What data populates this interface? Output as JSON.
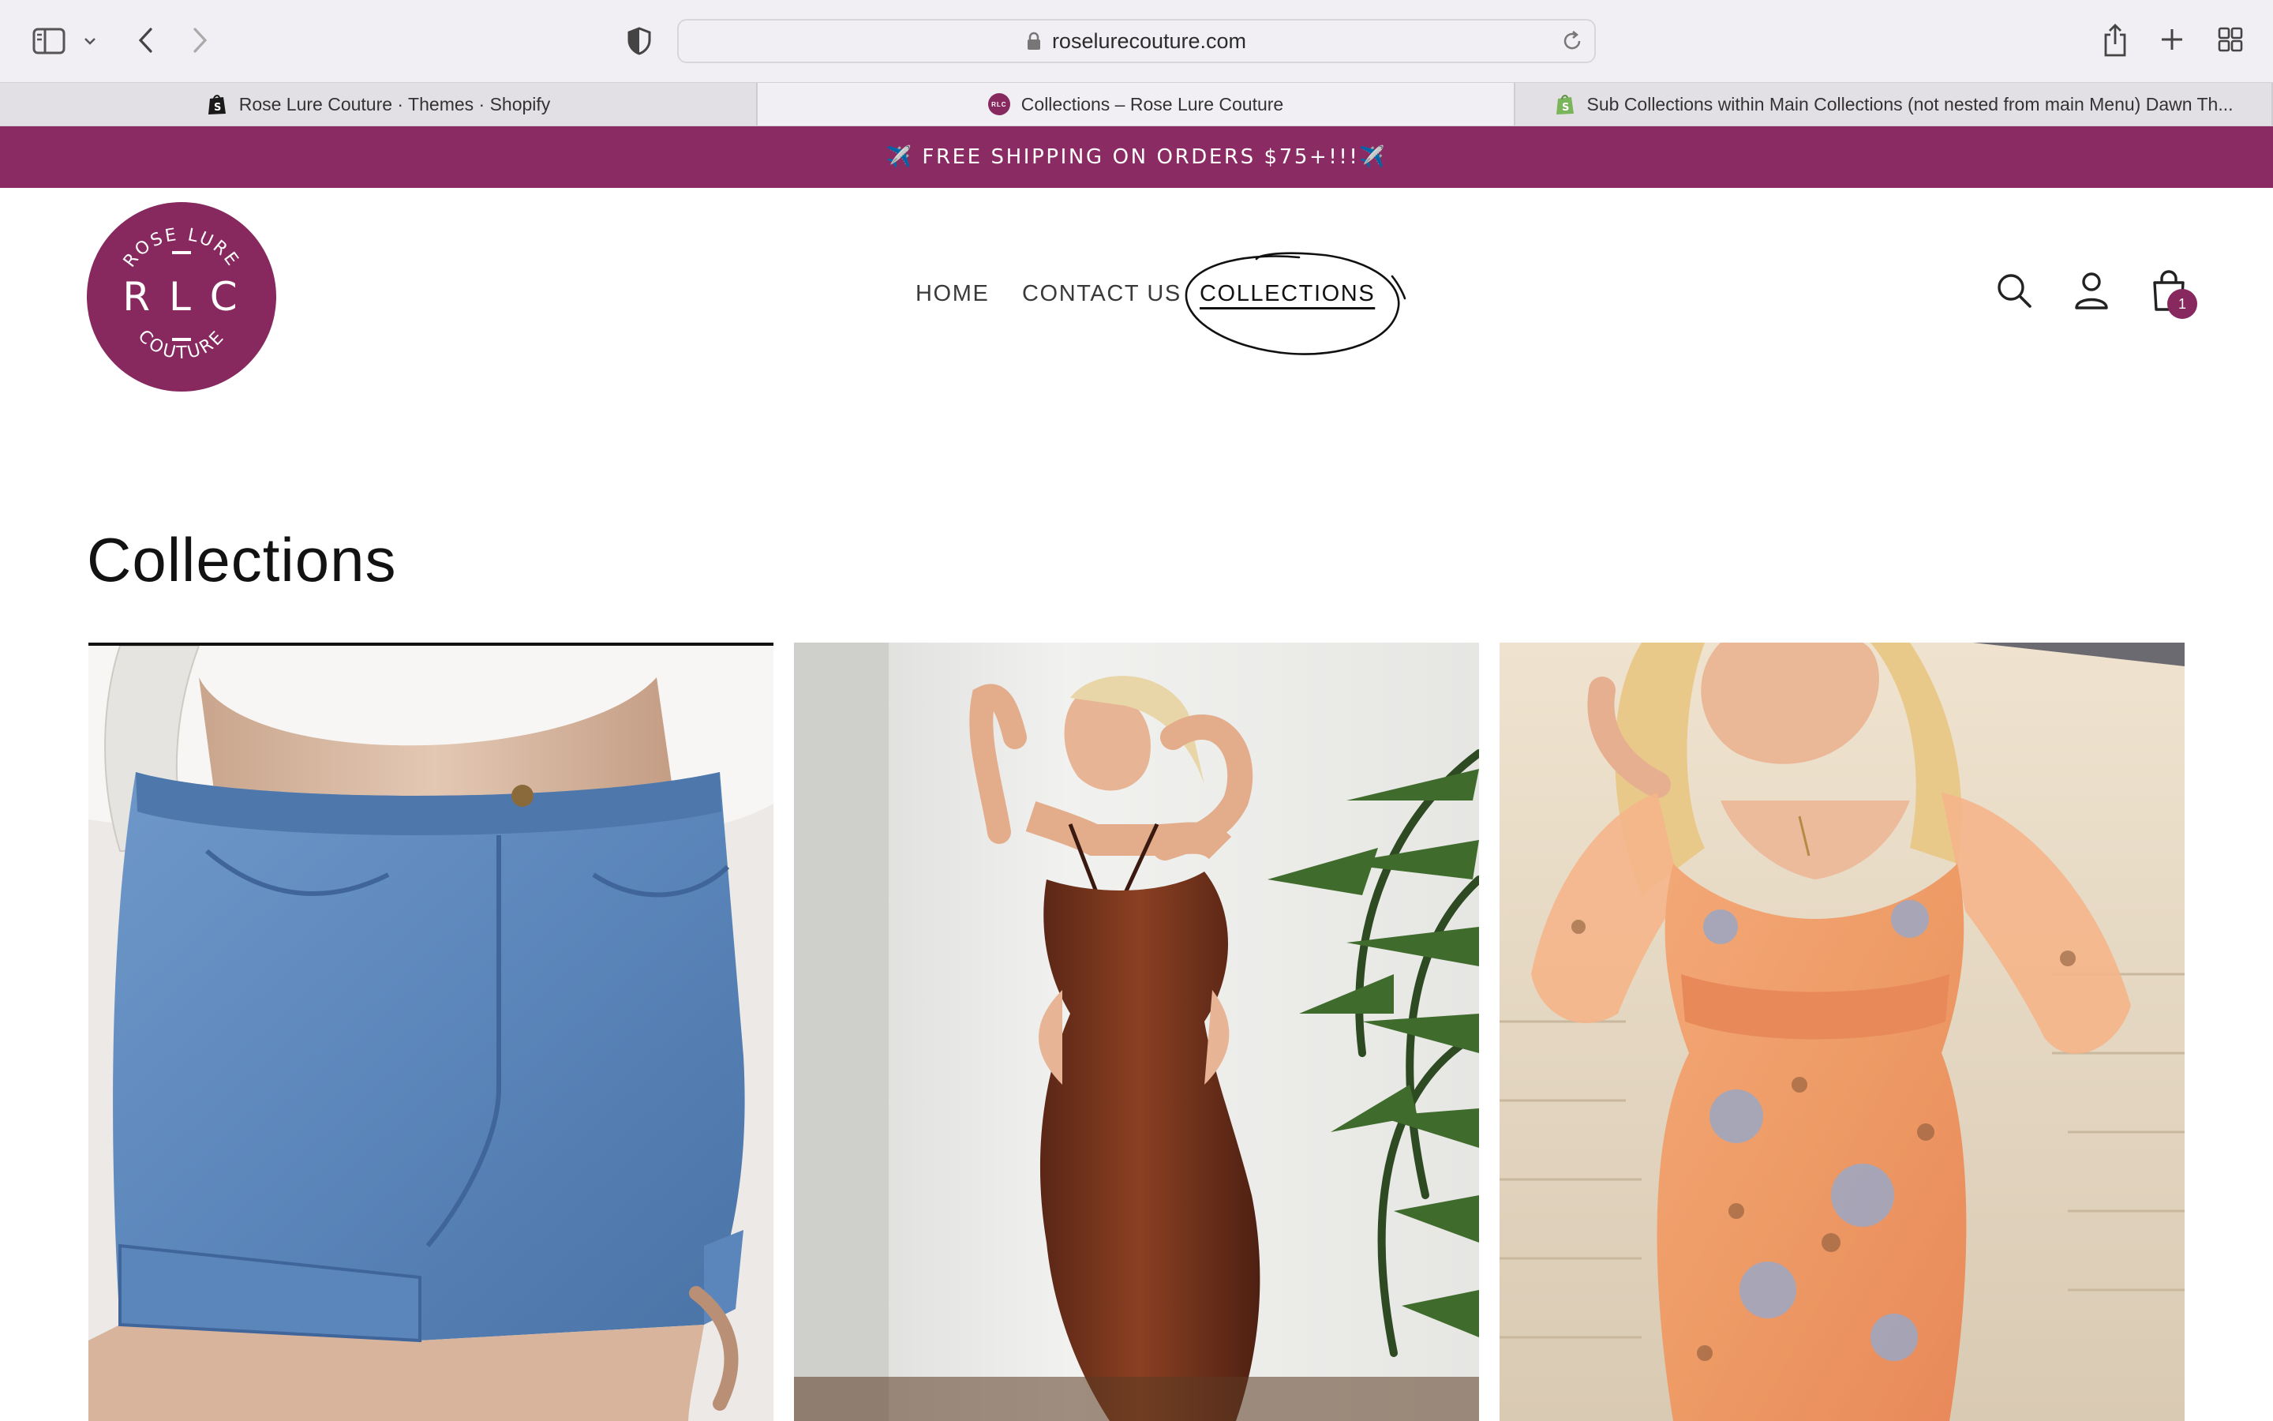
{
  "browser": {
    "url": "roselurecouture.com",
    "tabs": [
      {
        "label": "Rose Lure Couture · Themes · Shopify",
        "favicon": "shopify-bag-icon-dark",
        "active": false
      },
      {
        "label": "Collections – Rose Lure Couture",
        "favicon": "rlc-logo-icon",
        "active": true
      },
      {
        "label": "Sub Collections within Main Collections (not nested from main Menu) Dawn Th...",
        "favicon": "shopify-bag-icon-green",
        "active": false
      }
    ],
    "toolbar_icons": [
      "sidebar-icon",
      "chevron-down-icon",
      "back-icon",
      "forward-icon",
      "shield-icon",
      "lock-icon",
      "reload-icon",
      "share-icon",
      "new-tab-icon",
      "tab-overview-icon"
    ]
  },
  "store": {
    "announcement": "✈️ FREE SHIPPING ON ORDERS $75+!!!✈️",
    "logo": {
      "top_text": "ROSE LURE",
      "monogram": "R L C",
      "bottom_text": "COUTURE"
    },
    "nav": [
      {
        "label": "HOME",
        "current": false
      },
      {
        "label": "CONTACT US",
        "current": false
      },
      {
        "label": "COLLECTIONS",
        "current": true
      }
    ],
    "header_icons": [
      "search-icon",
      "account-icon",
      "cart-icon"
    ],
    "cart_count": "1",
    "page_title": "Collections",
    "collections": [
      {
        "image": "denim-shorts-photo"
      },
      {
        "image": "brown-halter-dress-photo"
      },
      {
        "image": "floral-orange-dress-photo"
      }
    ]
  },
  "colors": {
    "brand": "#87285f",
    "chrome_bg": "#f1eff3",
    "tab_inactive_bg": "#e2e0e4"
  }
}
